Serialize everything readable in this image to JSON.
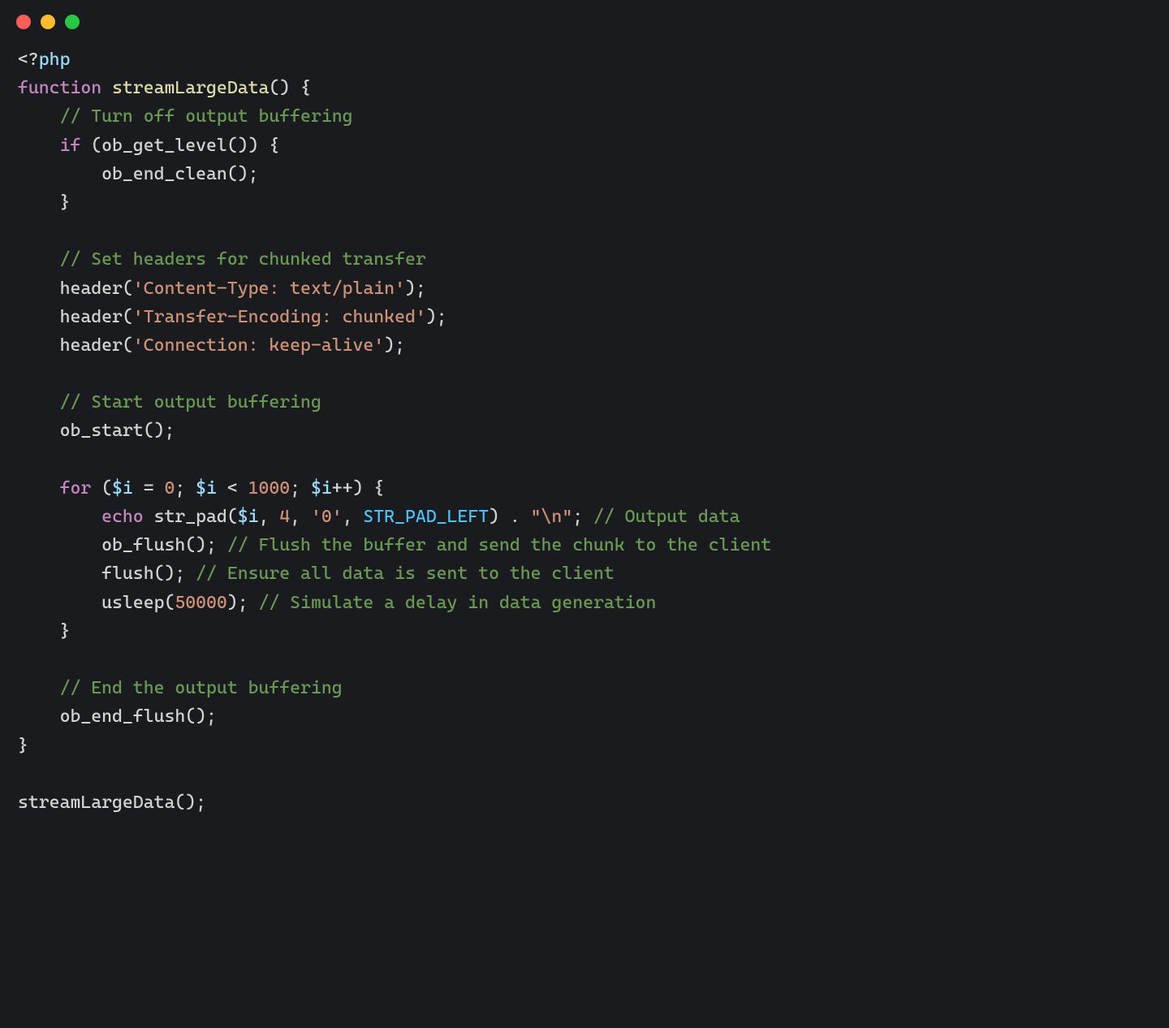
{
  "traffic_lights": {
    "red": "#ff5f57",
    "yellow": "#febc2e",
    "green": "#28c840"
  },
  "code": {
    "l0": {
      "a": "<?",
      "b": "php"
    },
    "l1": {
      "a": "function",
      "b": " streamLargeData",
      "c": "() {"
    },
    "l2": {
      "a": "    ",
      "b": "// Turn off output buffering"
    },
    "l3": {
      "a": "    ",
      "b": "if",
      "c": " (ob_get_level()) {"
    },
    "l4": {
      "a": "        ob_end_clean();"
    },
    "l5": {
      "a": "    }"
    },
    "l6": {
      "a": ""
    },
    "l7": {
      "a": "    ",
      "b": "// Set headers for chunked transfer"
    },
    "l8": {
      "a": "    header(",
      "b": "'Content-Type: text/plain'",
      "c": ");"
    },
    "l9": {
      "a": "    header(",
      "b": "'Transfer-Encoding: chunked'",
      "c": ");"
    },
    "l10": {
      "a": "    header(",
      "b": "'Connection: keep-alive'",
      "c": ");"
    },
    "l11": {
      "a": ""
    },
    "l12": {
      "a": "    ",
      "b": "// Start output buffering"
    },
    "l13": {
      "a": "    ob_start();"
    },
    "l14": {
      "a": ""
    },
    "l15": {
      "a": "    ",
      "b": "for",
      "c": " (",
      "d": "$i",
      "e": " = ",
      "f": "0",
      "g": "; ",
      "h": "$i",
      "i": " < ",
      "j": "1000",
      "k": "; ",
      "l": "$i",
      "m": "++) {"
    },
    "l16": {
      "a": "        ",
      "b": "echo",
      "c": " str_pad(",
      "d": "$i",
      "e": ", ",
      "f": "4",
      "g": ", ",
      "h": "'0'",
      "i": ", ",
      "j": "STR_PAD_LEFT",
      "k": ") . ",
      "l": "\"\\n\"",
      "m": "; ",
      "n": "// Output data"
    },
    "l17": {
      "a": "        ob_flush(); ",
      "b": "// Flush the buffer and send the chunk to the client"
    },
    "l18": {
      "a": "        flush(); ",
      "b": "// Ensure all data is sent to the client"
    },
    "l19": {
      "a": "        usleep(",
      "b": "50000",
      "c": "); ",
      "d": "// Simulate a delay in data generation"
    },
    "l20": {
      "a": "    }"
    },
    "l21": {
      "a": ""
    },
    "l22": {
      "a": "    ",
      "b": "// End the output buffering"
    },
    "l23": {
      "a": "    ob_end_flush();"
    },
    "l24": {
      "a": "}"
    },
    "l25": {
      "a": ""
    },
    "l26": {
      "a": "streamLargeData();"
    }
  }
}
